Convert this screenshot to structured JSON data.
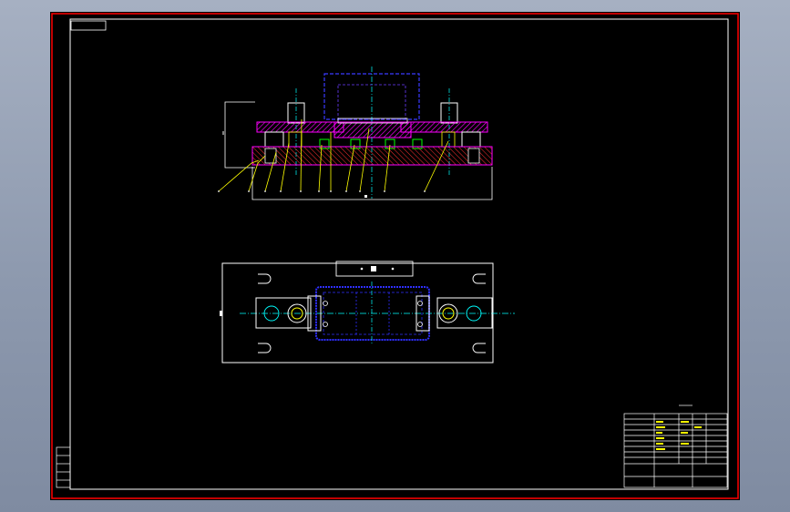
{
  "app": {
    "title": ""
  },
  "colors": {
    "canvas": "#000000",
    "frame_outer": "#ff0000",
    "frame_inner": "#ffffff",
    "part_outline": "#ffffff",
    "hatch": "#ff00ff",
    "fixture_body": "#0000ff",
    "centerline": "#00ffff",
    "leader": "#ffff00",
    "title_block": "#ffffff",
    "accent_green": "#00ff00"
  },
  "drawing": {
    "front_view_label": "",
    "top_view_label": "",
    "leader_count": 12,
    "title_block": {
      "parts_list_header": "",
      "drawing_name": "",
      "rows": 10
    },
    "revision_block": {
      "rows": 5
    }
  }
}
